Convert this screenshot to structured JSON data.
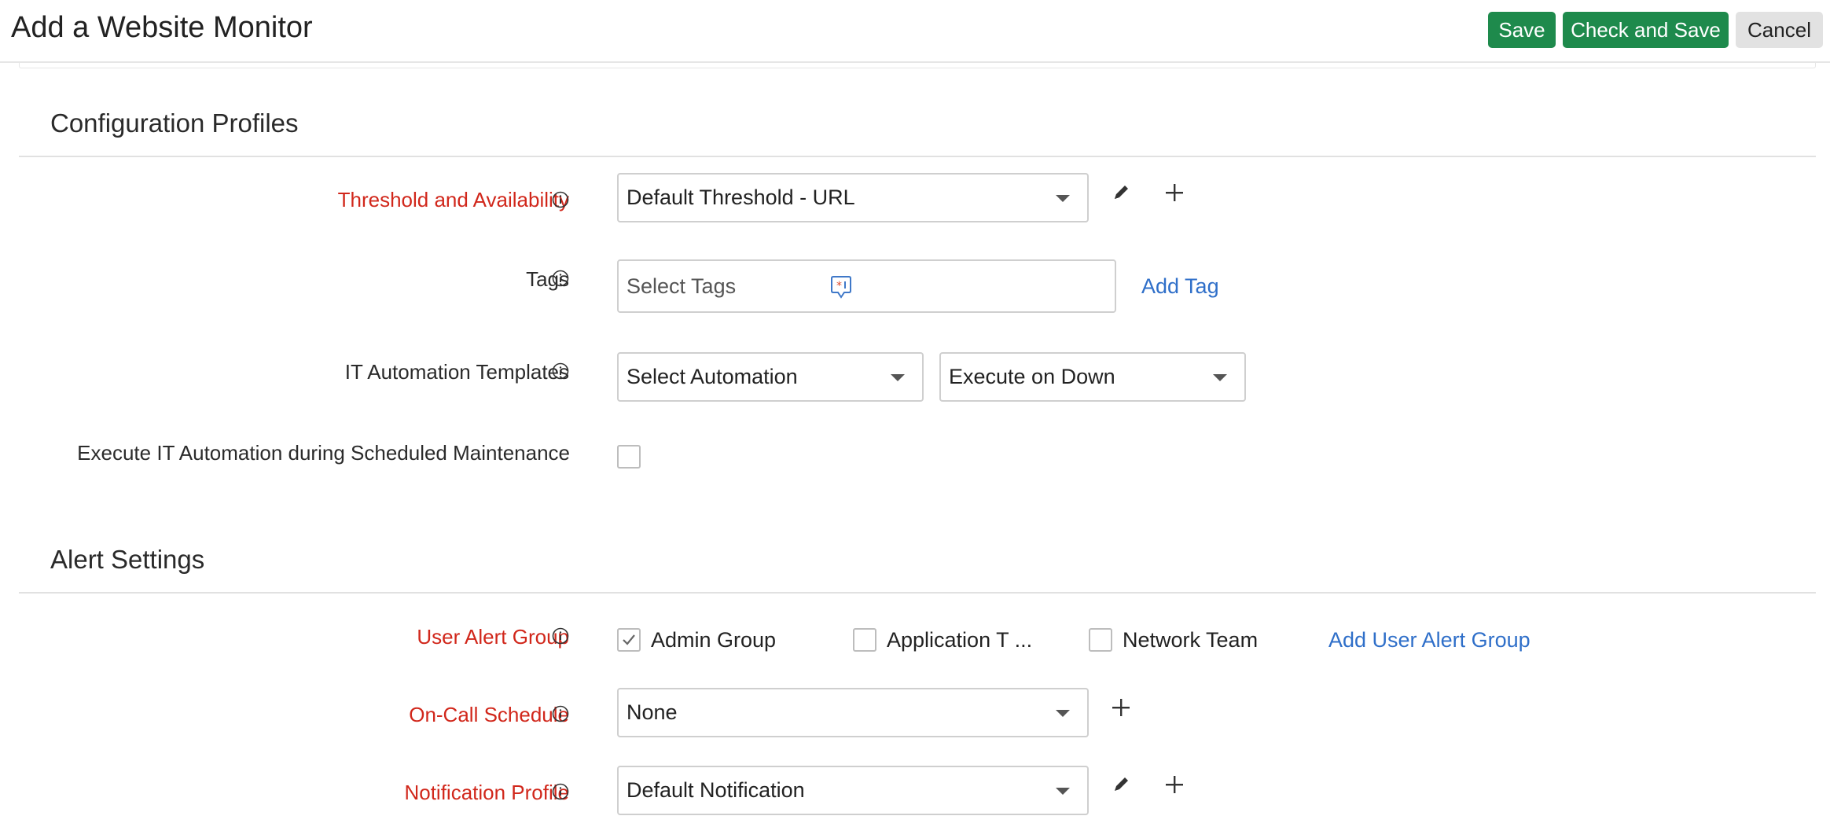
{
  "header": {
    "title": "Add a Website Monitor",
    "buttons": {
      "save": "Save",
      "check_and_save": "Check and Save",
      "cancel": "Cancel"
    },
    "colors": {
      "primary": "#1e8a4c",
      "secondary": "#e2e2e2"
    }
  },
  "configuration_profiles": {
    "section_title": "Configuration Profiles",
    "threshold": {
      "label": "Threshold and Availability",
      "value": "Default Threshold - URL",
      "required": true
    },
    "tags": {
      "label": "Tags",
      "placeholder": "Select Tags",
      "add_link": "Add Tag"
    },
    "it_automation": {
      "label": "IT Automation Templates",
      "automation_value": "Select Automation",
      "execute_value": "Execute on Down"
    },
    "maintenance": {
      "label": "Execute IT Automation during Scheduled Maintenance",
      "checked": false
    }
  },
  "alert_settings": {
    "section_title": "Alert Settings",
    "user_alert_group": {
      "label": "User Alert Group",
      "options": [
        {
          "label": "Admin Group",
          "checked": true
        },
        {
          "label": "Application T ...",
          "checked": false
        },
        {
          "label": "Network Team",
          "checked": false
        }
      ],
      "add_link": "Add User Alert Group"
    },
    "on_call_schedule": {
      "label": "On-Call Schedule",
      "value": "None"
    },
    "notification_profile": {
      "label": "Notification Profile",
      "value": "Default Notification"
    }
  },
  "colors": {
    "required_label": "#d1271b",
    "link": "#2f6fc9"
  },
  "icons": [
    "info-icon",
    "edit-pencil-icon",
    "add-plus-icon",
    "tag-icon",
    "chevron-down-icon",
    "checkmark-icon"
  ]
}
